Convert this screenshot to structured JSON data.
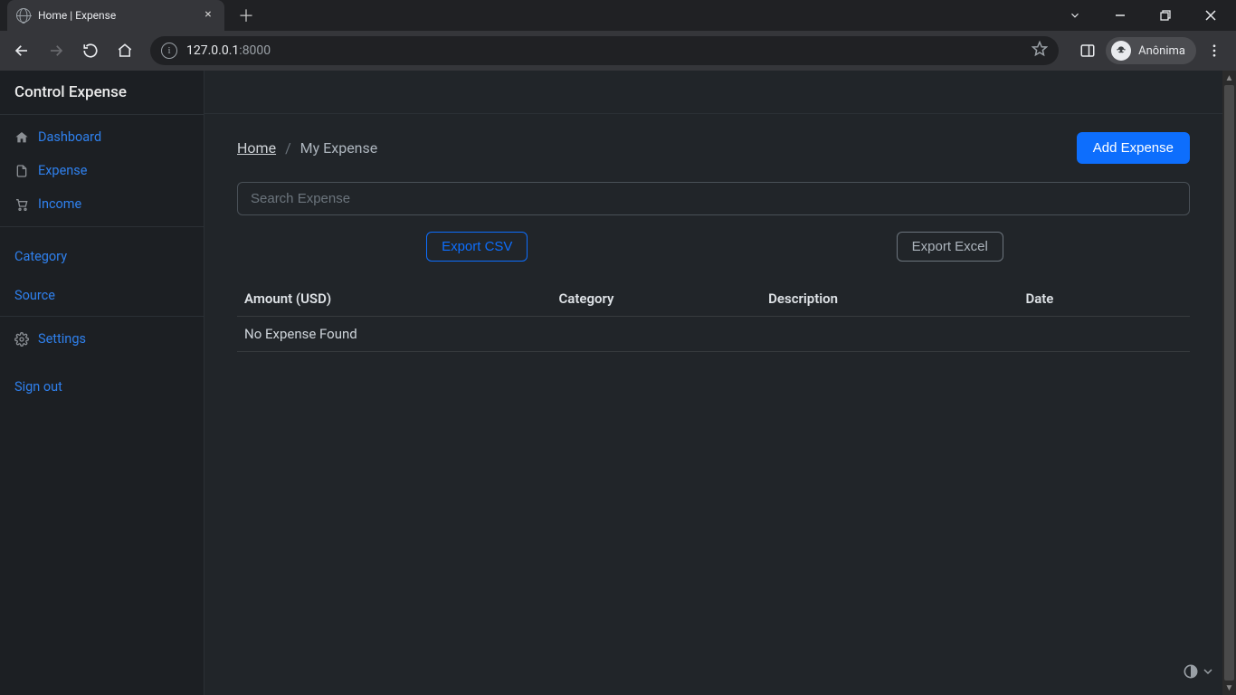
{
  "browser": {
    "tab_title": "Home | Expense",
    "url_host": "127.0.0.1",
    "url_port": ":8000",
    "profile_label": "Anônima"
  },
  "sidebar": {
    "brand": "Control Expense",
    "nav": [
      {
        "label": "Dashboard"
      },
      {
        "label": "Expense"
      },
      {
        "label": "Income"
      }
    ],
    "cats": [
      {
        "label": "Category"
      },
      {
        "label": "Source"
      }
    ],
    "settings_label": "Settings",
    "signout_label": "Sign out"
  },
  "breadcrumb": {
    "home": "Home",
    "sep": "/",
    "current": "My Expense"
  },
  "actions": {
    "add": "Add Expense",
    "export_csv": "Export CSV",
    "export_excel": "Export Excel"
  },
  "search": {
    "placeholder": "Search Expense"
  },
  "table": {
    "headers": {
      "amount": "Amount (USD)",
      "category": "Category",
      "description": "Description",
      "date": "Date"
    },
    "empty": "No Expense Found"
  }
}
